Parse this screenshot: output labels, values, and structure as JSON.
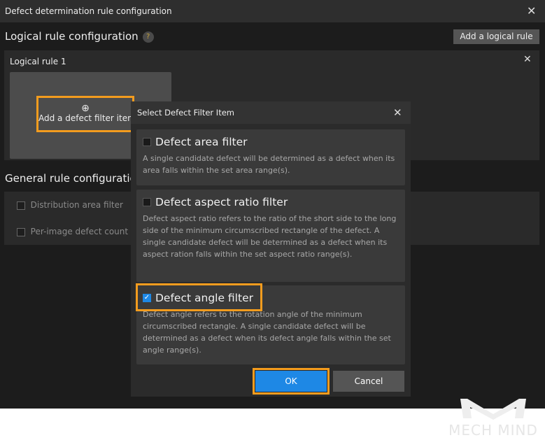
{
  "window": {
    "title": "Defect determination rule configuration"
  },
  "logical": {
    "heading": "Logical rule configuration",
    "help": "?",
    "add_button": "Add a logical rule",
    "rule_title": "Logical rule 1",
    "add_filter": "Add a defect filter item"
  },
  "general": {
    "heading": "General rule configuration",
    "items": [
      {
        "label": "Distribution area filter"
      },
      {
        "label": "Per-image defect count"
      }
    ]
  },
  "dialog": {
    "title": "Select Defect Filter Item",
    "items": [
      {
        "title": "Defect area filter",
        "checked": false,
        "desc": "A single candidate defect will be determined as a defect when its area falls within the set area range(s)."
      },
      {
        "title": "Defect aspect ratio filter",
        "checked": false,
        "desc": "Defect aspect ratio refers to the ratio of the short side to the long side of the minimum circumscribed rectangle of the defect. A single candidate defect will be determined as a defect when its aspect ration falls within the set aspect ratio range(s)."
      },
      {
        "title": "Defect angle filter",
        "checked": true,
        "desc": "Defect angle refers to the rotation angle of the minimum circumscribed rectangle. A single candidate defect will be determined as a defect when its defect angle falls within the set angle range(s)."
      }
    ],
    "ok": "OK",
    "cancel": "Cancel"
  },
  "watermark": "MECH MIND",
  "colors": {
    "accent": "#1e88e5",
    "highlight": "#f39c1e"
  }
}
